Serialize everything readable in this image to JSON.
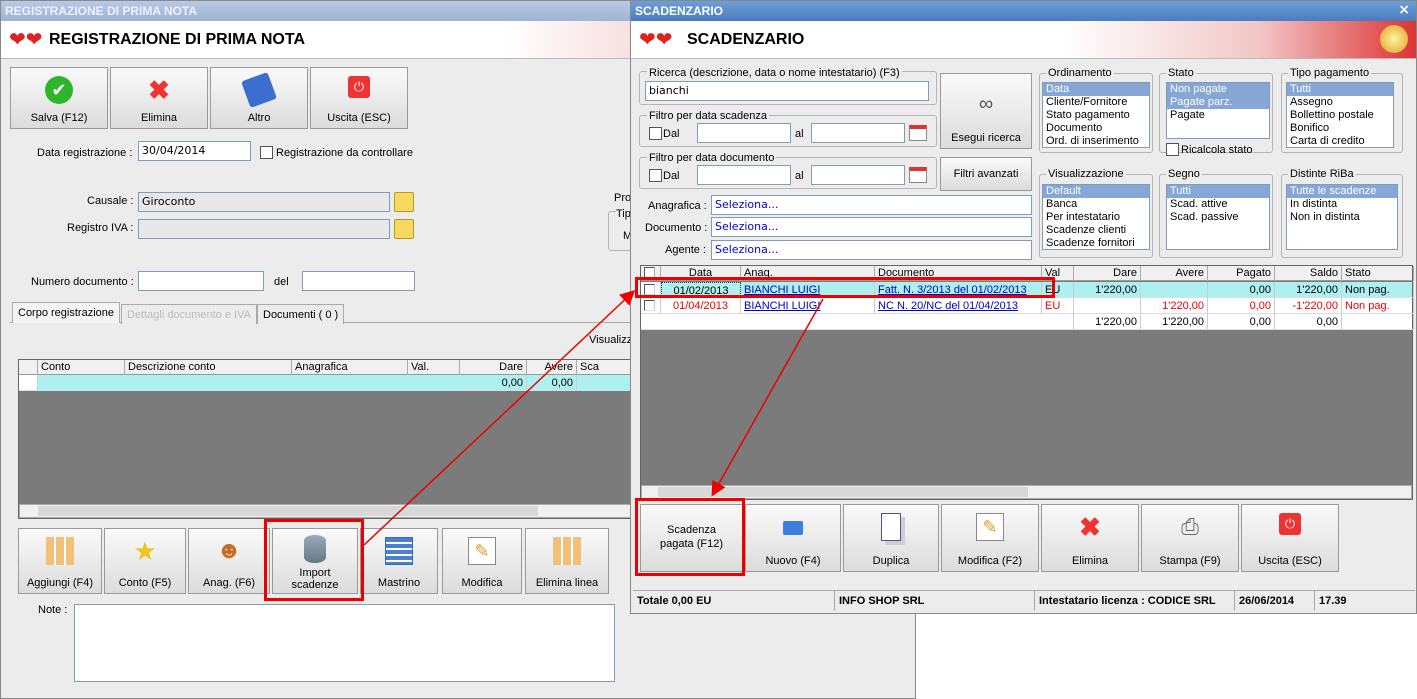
{
  "left": {
    "window_title": "REGISTRAZIONE DI PRIMA NOTA",
    "header_title": "REGISTRAZIONE DI PRIMA NOTA",
    "toolbar": [
      {
        "label": "Salva (F12)",
        "icon": "check-icon"
      },
      {
        "label": "Elimina",
        "icon": "delete-x-icon"
      },
      {
        "label": "Altro",
        "icon": "book-search-icon"
      },
      {
        "label": "Uscita (ESC)",
        "icon": "exit-power-icon"
      }
    ],
    "data_registrazione_label": "Data registrazione :",
    "data_registrazione": "30/04/2014",
    "da_controllare_label": "Registrazione da controllare",
    "causale_label": "Causale :",
    "causale": "Giroconto",
    "registro_iva_label": "Registro IVA :",
    "registro_iva": "",
    "numero_doc_label": "Numero documento :",
    "del_label": "del",
    "pro_label": "Pro",
    "tip_label": "Tip",
    "m_label": "M",
    "tabs": [
      "Corpo registrazione",
      "Dettagli documento e IVA",
      "Documenti ( 0 )"
    ],
    "visualizza_label": "Visualizz",
    "grid_headers": [
      "Conto",
      "Descrizione conto",
      "Anagrafica",
      "Val.",
      "Dare",
      "Avere",
      "Sca"
    ],
    "grid_row": {
      "dare": "0,00",
      "avere": "0,00"
    },
    "bottom_buttons": [
      {
        "label": "Aggiungi (F4)",
        "icon": "grid-add-icon"
      },
      {
        "label": "Conto (F5)",
        "icon": "star-add-icon"
      },
      {
        "label": "Anag. (F6)",
        "icon": "user-add-icon"
      },
      {
        "label": "Import scadenze",
        "icon": "database-import-icon"
      },
      {
        "label": "Mastrino",
        "icon": "calendar-grid-icon"
      },
      {
        "label": "Modifica",
        "icon": "edit-pencil-icon"
      },
      {
        "label": "Elimina linea",
        "icon": "grid-delete-icon"
      }
    ],
    "note_label": "Note :"
  },
  "right": {
    "window_title": "SCADENZARIO",
    "close": "×",
    "header_title": "SCADENZARIO",
    "ricerca_label": "Ricerca (descrizione, data o nome intestatario) (F3)",
    "ricerca": "bianchi",
    "filtro_scadenza_label": "Filtro per data scadenza",
    "filtro_documento_label": "Filtro per data documento",
    "dal_label": "Dal",
    "al_label": "al",
    "esegui_ricerca": "Esegui ricerca",
    "filtri_avanzati": "Filtri avanzati",
    "ordinamento": {
      "title": "Ordinamento",
      "items": [
        "Data",
        "Cliente/Fornitore",
        "Stato pagamento",
        "Documento",
        "Ord. di inserimento"
      ],
      "selected": 0
    },
    "stato": {
      "title": "Stato",
      "items": [
        "Non pagate",
        "Pagate parz.",
        "Pagate"
      ],
      "selected": [
        0,
        1
      ]
    },
    "ricalcola_stato": "Ricalcola stato",
    "tipo_pagamento": {
      "title": "Tipo pagamento",
      "items": [
        "Tutti",
        "Assegno",
        "Bollettino postale",
        "Bonifico",
        "Carta di credito"
      ],
      "selected": 0
    },
    "visualizzazione": {
      "title": "Visualizzazione",
      "items": [
        "Default",
        "Banca",
        "Per intestatario",
        "Scadenze clienti",
        "Scadenze fornitori"
      ],
      "selected": 0
    },
    "segno": {
      "title": "Segno",
      "items": [
        "Tutti",
        "Scad. attive",
        "Scad. passive"
      ],
      "selected": 0
    },
    "distinte": {
      "title": "Distinte RiBa",
      "items": [
        "Tutte le scadenze",
        "In distinta",
        "Non in distinta"
      ],
      "selected": 0
    },
    "anagrafica_label": "Anagrafica :",
    "documento_label": "Documento :",
    "agente_label": "Agente :",
    "seleziona": "Seleziona...",
    "grid_headers": [
      "Data",
      "Anag.",
      "Documento",
      "Val",
      "Dare",
      "Avere",
      "Pagato",
      "Saldo",
      "Stato"
    ],
    "rows": [
      {
        "data": "01/02/2013",
        "anag": "BIANCHI LUIGI",
        "documento": "Fatt. N. 3/2013 del 01/02/2013",
        "val": "EU",
        "dare": "1'220,00",
        "avere": "",
        "pagato": "0,00",
        "saldo": "1'220,00",
        "stato": "Non pag."
      },
      {
        "data": "01/04/2013",
        "anag": "BIANCHI LUIGI",
        "documento": "NC N. 20/NC del 01/04/2013",
        "val": "EU",
        "dare": "",
        "avere": "1'220,00",
        "pagato": "0,00",
        "saldo": "-1'220,00",
        "stato": "Non pag."
      }
    ],
    "totals": {
      "dare": "1'220,00",
      "avere": "1'220,00",
      "pagato": "0,00",
      "saldo": "0,00"
    },
    "buttons": [
      {
        "label": "Scadenza pagata (F12)"
      },
      {
        "label": "Nuovo (F4)",
        "icon": "new-add-icon"
      },
      {
        "label": "Duplica",
        "icon": "duplicate-icon"
      },
      {
        "label": "Modifica (F2)",
        "icon": "edit-pencil-icon"
      },
      {
        "label": "Elimina",
        "icon": "delete-x-icon"
      },
      {
        "label": "Stampa (F9)",
        "icon": "printer-icon"
      },
      {
        "label": "Uscita (ESC)",
        "icon": "exit-power-icon"
      }
    ],
    "status": [
      "Totale 0,00 EU",
      "INFO SHOP SRL",
      "Intestatario licenza : CODICE SRL",
      "26/06/2014",
      "17.39"
    ]
  },
  "colors": {
    "accent_red": "#e00000",
    "selection_blue": "#86a6d6",
    "row_highlight": "#aef0f0"
  }
}
